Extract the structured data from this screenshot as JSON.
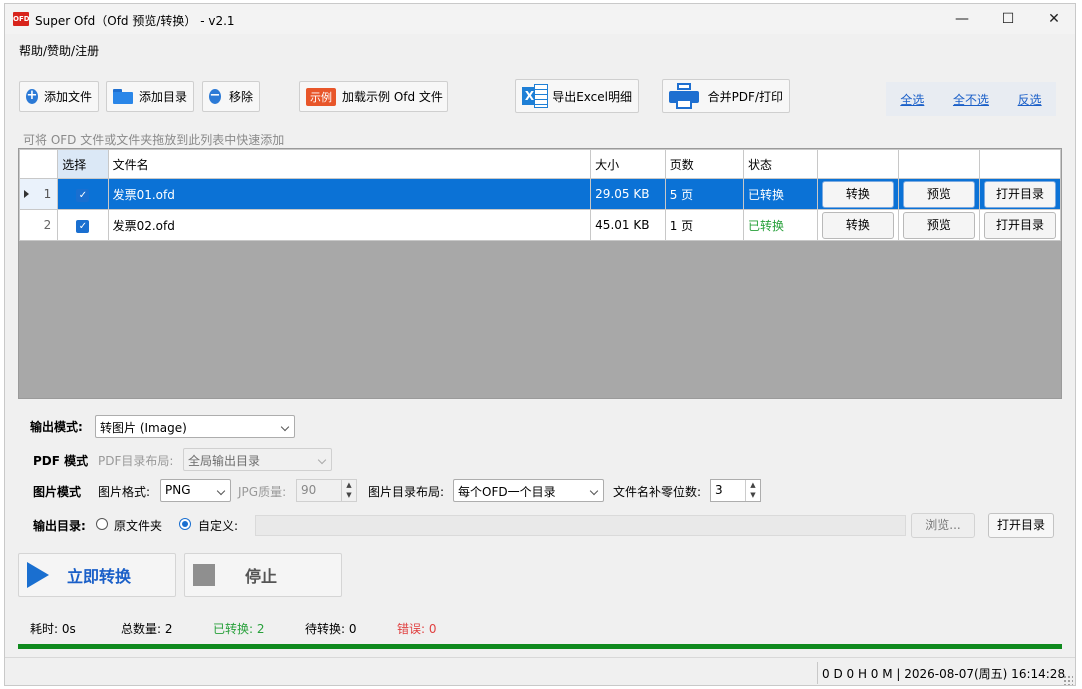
{
  "window": {
    "icon_text": "OFD",
    "title": "Super Ofd（Ofd 预览/转换） - v2.1",
    "min_glyph": "—",
    "max_glyph": "☐",
    "close_glyph": "✕"
  },
  "menu": {
    "help": "帮助/赞助/注册"
  },
  "toolbar": {
    "add_file": "添加文件",
    "add_folder": "添加目录",
    "remove": "移除",
    "sample_badge": "示例",
    "load_sample": "加载示例 Ofd 文件",
    "export_excel": "导出Excel明细",
    "merge_pdf_print": "合并PDF/打印",
    "select_all": "全选",
    "select_none": "全不选",
    "invert": "反选"
  },
  "hint": "可将 OFD 文件或文件夹拖放到此列表中快速添加",
  "table": {
    "headers": {
      "select": "选择",
      "filename": "文件名",
      "size": "大小",
      "pages": "页数",
      "status": "状态"
    },
    "rows": [
      {
        "index": "1",
        "filename": "发票01.ofd",
        "size": "29.05 KB",
        "pages": "5 页",
        "status": "已转换",
        "convert": "转换",
        "preview": "预览",
        "open_dir": "打开目录"
      },
      {
        "index": "2",
        "filename": "发票02.ofd",
        "size": "45.01 KB",
        "pages": "1 页",
        "status": "已转换",
        "convert": "转换",
        "preview": "预览",
        "open_dir": "打开目录"
      }
    ]
  },
  "options": {
    "output_mode_label": "输出模式:",
    "output_mode_value": "转图片 (Image)",
    "pdf_mode_label": "PDF 模式",
    "pdf_layout_label": "PDF目录布局:",
    "pdf_layout_value": "全局输出目录",
    "image_mode_label": "图片模式",
    "image_format_label": "图片格式:",
    "image_format_value": "PNG",
    "jpg_quality_label": "JPG质量:",
    "jpg_quality_value": "90",
    "image_layout_label": "图片目录布局:",
    "image_layout_value": "每个OFD一个目录",
    "zero_pad_label": "文件名补零位数:",
    "zero_pad_value": "3",
    "output_dir_label": "输出目录:",
    "radio_original": "原文件夹",
    "radio_custom": "自定义:",
    "browse": "浏览...",
    "open_dir": "打开目录"
  },
  "actions": {
    "convert_now": "立即转换",
    "stop": "停止"
  },
  "stats": {
    "elapsed": "耗时: 0s",
    "total": "总数量: 2",
    "done": "已转换: 2",
    "pending": "待转换: 0",
    "errors": "错误: 0"
  },
  "progress": {
    "percent": 100
  },
  "statusbar": {
    "text": "0 D 0 H 0 M | 2026-08-07(周五) 16:14:28"
  },
  "colors": {
    "accent": "#1a6fd0",
    "success": "#27a03a",
    "error": "#e04040",
    "progress": "#0f8a1e"
  }
}
